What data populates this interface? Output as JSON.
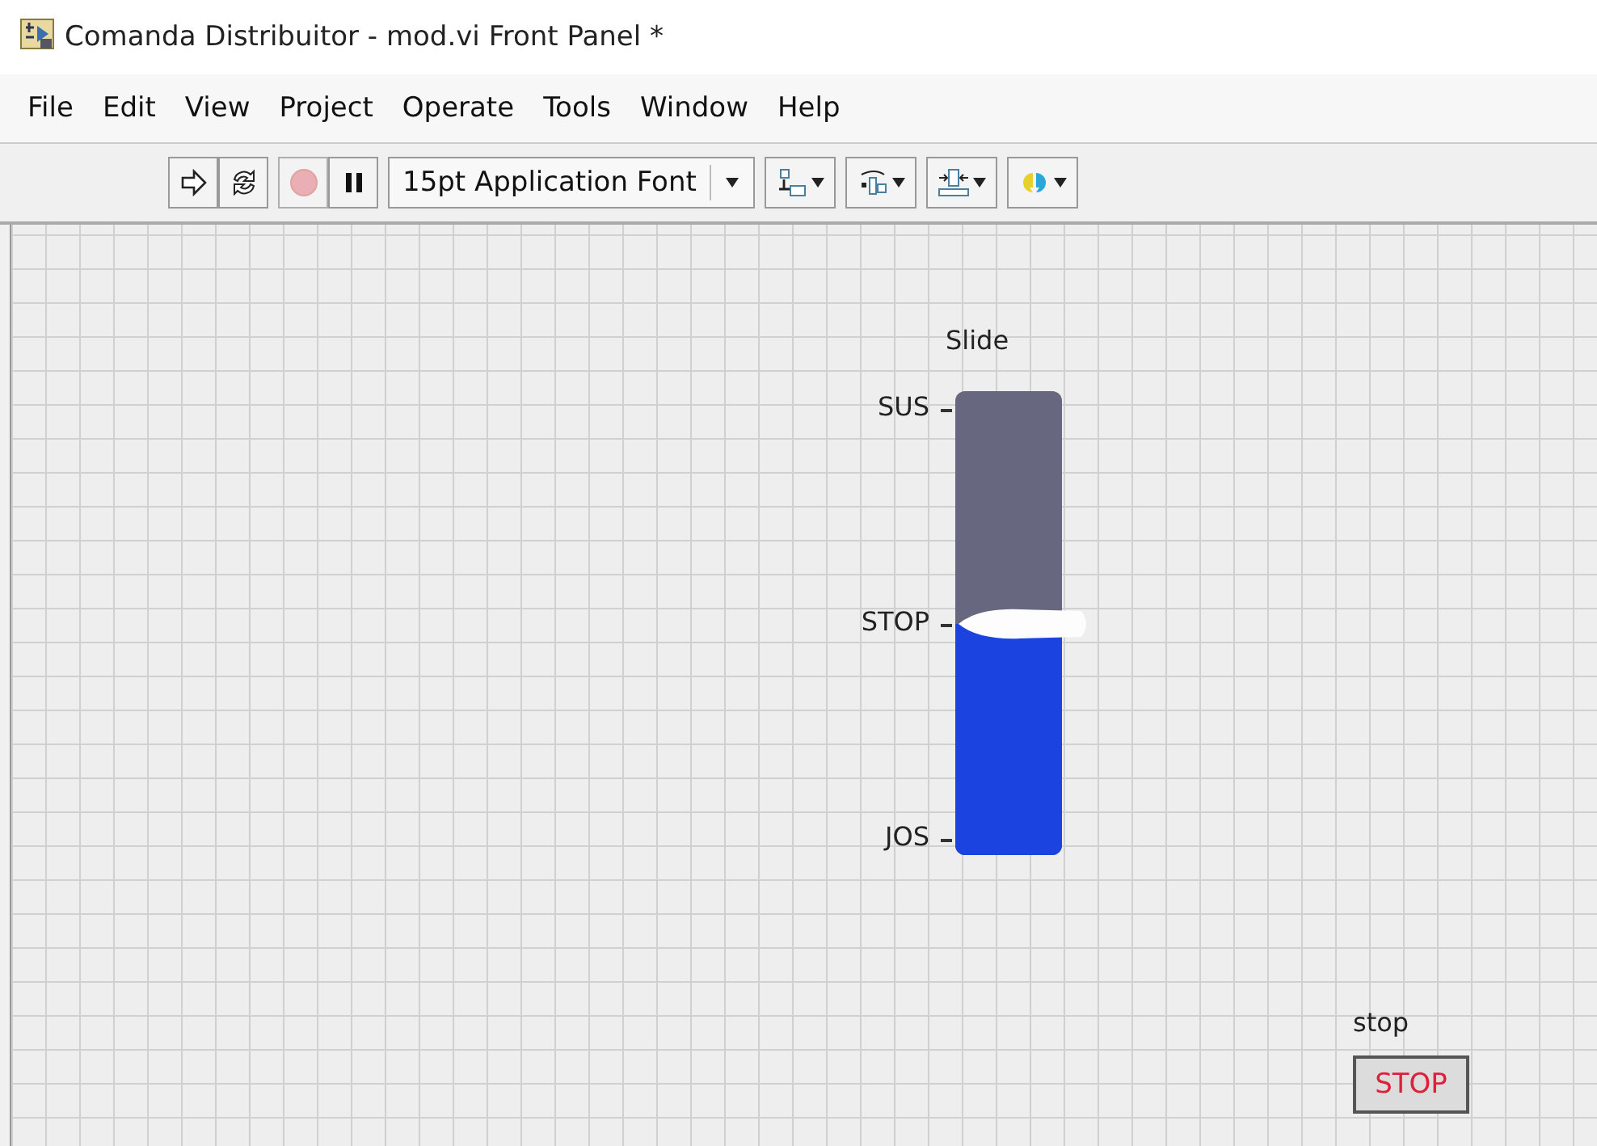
{
  "window": {
    "title": "Comanda Distribuitor - mod.vi Front Panel *"
  },
  "menu": [
    "File",
    "Edit",
    "View",
    "Project",
    "Operate",
    "Tools",
    "Window",
    "Help"
  ],
  "toolbar": [
    {
      "kind": "run"
    },
    {
      "kind": "run-continuous"
    },
    {
      "kind": "abort",
      "disabled": true
    },
    {
      "kind": "pause"
    },
    {
      "kind": "font",
      "text": "15pt Application Font"
    },
    {
      "kind": "align"
    },
    {
      "kind": "distribute"
    },
    {
      "kind": "resize"
    },
    {
      "kind": "reorder"
    }
  ],
  "slide": {
    "label": "Slide",
    "level": 0.5,
    "scale": [
      "SUS",
      "STOP",
      "JOS"
    ]
  },
  "stop_button": {
    "label": "stop",
    "text": "STOP"
  }
}
